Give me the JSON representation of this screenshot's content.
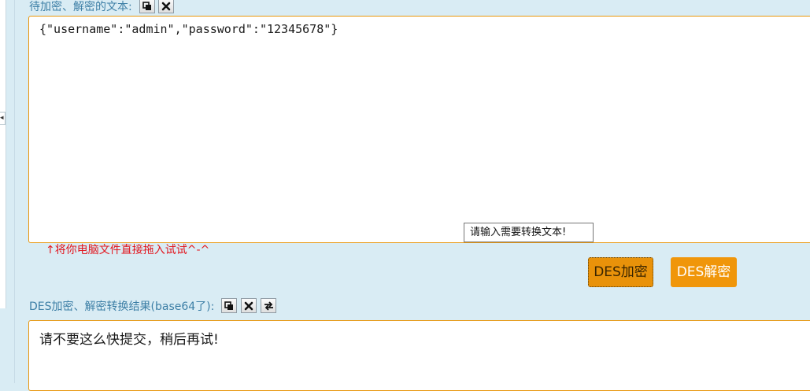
{
  "input_section": {
    "label": "待加密、解密的文本:",
    "text": "{\"username\":\"admin\",\"password\":\"12345678\"}",
    "drag_hint": "↑将你电脑文件直接拖入试试^-^",
    "tooltip": "请输入需要转换文本!",
    "tools": [
      "copy-icon",
      "clear-icon"
    ]
  },
  "actions": {
    "encrypt_label": "DES加密",
    "decrypt_label": "DES解密"
  },
  "output_section": {
    "label": "DES加密、解密转换结果(base64了):",
    "text": "请不要这么快提交，稍后再试!",
    "tools": [
      "copy-icon",
      "clear-icon",
      "swap-icon"
    ]
  },
  "colors": {
    "background": "#d9ecf4",
    "label": "#3d7fa6",
    "accent": "#f0960a",
    "hint": "#e2141c"
  }
}
